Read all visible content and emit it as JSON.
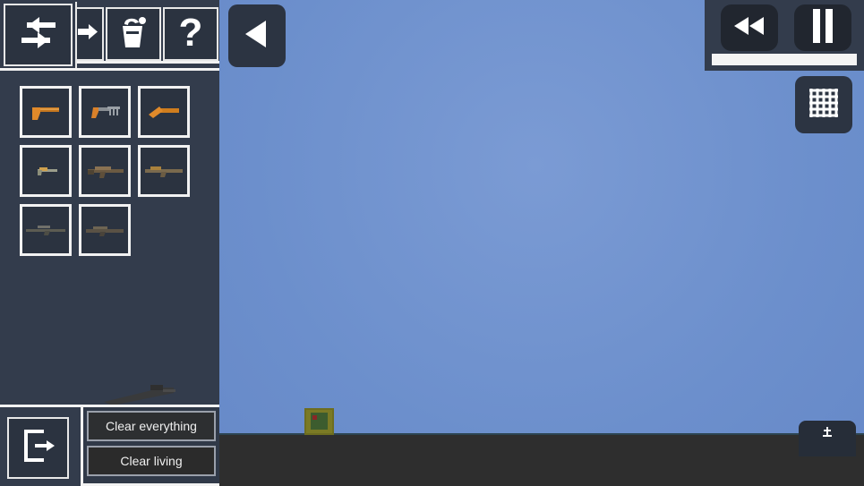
{
  "scene": {
    "sky_color": "#6c8fcc",
    "ground_color": "#2e2e2e",
    "entity": {
      "name": "crate-entity",
      "body_color": "#7a7a25",
      "core_color": "#3c5c2e",
      "marker_color": "#8a2626"
    }
  },
  "left_panel": {
    "background_color": "#333c4c",
    "toolbar": {
      "items": [
        {
          "id": "swap",
          "icon": "swap-arrows-icon",
          "label": "Swap"
        },
        {
          "id": "insert",
          "icon": "arrow-right-icon",
          "label": "Insert"
        },
        {
          "id": "paint",
          "icon": "paint-bucket-icon",
          "label": "Paint"
        },
        {
          "id": "help",
          "icon": "question-mark-icon",
          "label": "Help"
        }
      ]
    },
    "inventory": {
      "columns": 3,
      "slot_border_color": "#f2f2f2",
      "slot_fill_color": "#2b3340",
      "items": [
        {
          "id": "slot-1",
          "label": "Pistol",
          "icon": "pistol-icon",
          "tint": "#c4761f"
        },
        {
          "id": "slot-2",
          "label": "Machine Pistol",
          "icon": "machine-pistol-icon",
          "tint": "#c4761f"
        },
        {
          "id": "slot-3",
          "label": "Sawed-off",
          "icon": "sawed-off-icon",
          "tint": "#cf7d1e"
        },
        {
          "id": "slot-4",
          "label": "SMG",
          "icon": "smg-icon",
          "tint": "#8c8f7a"
        },
        {
          "id": "slot-5",
          "label": "Assault Rifle",
          "icon": "assault-rifle-icon",
          "tint": "#6b5a42"
        },
        {
          "id": "slot-6",
          "label": "Carbine",
          "icon": "carbine-icon",
          "tint": "#7a6a4e"
        },
        {
          "id": "slot-7",
          "label": "Sniper Rifle",
          "icon": "sniper-rifle-icon",
          "tint": "#5c5c52"
        },
        {
          "id": "slot-8",
          "label": "Shotgun",
          "icon": "shotgun-icon",
          "tint": "#5a5245"
        }
      ]
    },
    "drag_item": {
      "label": "Rifle",
      "icon": "dragged-rifle-icon",
      "tint": "#3a3a3a"
    },
    "bottom": {
      "exit": {
        "icon": "exit-door-icon",
        "label": "Exit"
      },
      "clear_everything_label": "Clear everything",
      "clear_living_label": "Clear living"
    }
  },
  "overlay_controls": {
    "back": {
      "icon": "triangle-left-icon",
      "label": "Back"
    },
    "playback": {
      "rewind": {
        "icon": "rewind-icon",
        "label": "Rewind"
      },
      "pause": {
        "icon": "pause-icon",
        "label": "Pause"
      },
      "timeline": {
        "label": "Timeline",
        "progress": 100,
        "fill_color": "#f4f4f4"
      }
    },
    "grid": {
      "icon": "grid-icon",
      "label": "Grid"
    },
    "bottom_right": {
      "icon": "anchor-icon",
      "label": "Spawn"
    }
  }
}
